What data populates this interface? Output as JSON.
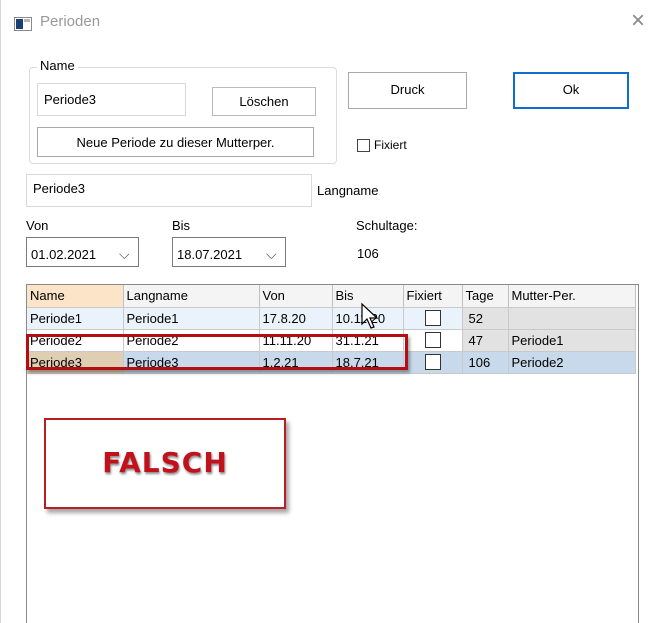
{
  "window": {
    "title": "Perioden",
    "close_glyph": "×"
  },
  "group": {
    "legend": "Name",
    "name_value": "Periode3",
    "loeschen_label": "Löschen",
    "neue_label": "Neue Periode zu dieser Mutterper."
  },
  "buttons": {
    "druck_label": "Druck",
    "ok_label": "Ok"
  },
  "fixiert": {
    "label": "Fixiert",
    "checked": false
  },
  "langname": {
    "value": "Periode3",
    "label": "Langname"
  },
  "dates": {
    "von_label": "Von",
    "von_value": "01.02.2021",
    "bis_label": "Bis",
    "bis_value": "18.07.2021",
    "chevron": "⌵"
  },
  "schultage": {
    "label": "Schultage:",
    "value": "106"
  },
  "grid": {
    "headers": [
      "Name",
      "Langname",
      "Von",
      "Bis",
      "Fixiert",
      "Tage",
      "Mutter-Per."
    ],
    "rows": [
      {
        "name": "Periode1",
        "langname": "Periode1",
        "von": "17.8.20",
        "bis": "10.11.20",
        "fixiert": false,
        "tage": "52",
        "mutter": ""
      },
      {
        "name": "Periode2",
        "langname": "Periode2",
        "von": "11.11.20",
        "bis": "31.1.21",
        "fixiert": false,
        "tage": "47",
        "mutter": "Periode1"
      },
      {
        "name": "Periode3",
        "langname": "Periode3",
        "von": "1.2.21",
        "bis": "18.7.21",
        "fixiert": false,
        "tage": "106",
        "mutter": "Periode2"
      }
    ]
  },
  "annotation": {
    "text": "FALSCH",
    "color": "#c1121b"
  },
  "colors": {
    "accent": "#0f6fd1",
    "highlight_red": "#b50d14"
  }
}
